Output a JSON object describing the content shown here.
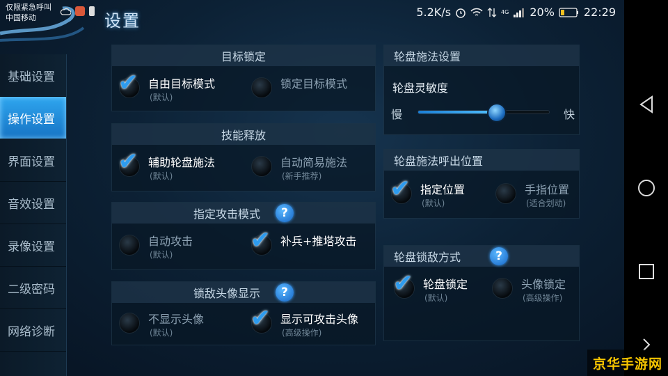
{
  "status_bar": {
    "emergency": "仅限紧急呼叫",
    "carrier": "中国移动",
    "speed": "5.2K/s",
    "battery_pct": "20%",
    "time": "22:29",
    "signal": "4G"
  },
  "title": "设置",
  "sidebar": {
    "items": [
      {
        "label": "基础设置",
        "active": false
      },
      {
        "label": "操作设置",
        "active": true
      },
      {
        "label": "界面设置",
        "active": false
      },
      {
        "label": "音效设置",
        "active": false
      },
      {
        "label": "录像设置",
        "active": false
      },
      {
        "label": "二级密码",
        "active": false
      },
      {
        "label": "网络诊断",
        "active": false
      }
    ]
  },
  "target_lock": {
    "header": "目标锁定",
    "options": [
      {
        "label": "自由目标模式",
        "sub": "(默认)",
        "selected": true
      },
      {
        "label": "锁定目标模式",
        "sub": "",
        "selected": false
      }
    ]
  },
  "skill_release": {
    "header": "技能释放",
    "options": [
      {
        "label": "辅助轮盘施法",
        "sub": "(默认)",
        "selected": true
      },
      {
        "label": "自动简易施法",
        "sub": "(新手推荐)",
        "selected": false
      }
    ]
  },
  "attack_mode": {
    "header": "指定攻击模式",
    "help": "?",
    "options": [
      {
        "label": "自动攻击",
        "sub": "(默认)",
        "selected": false
      },
      {
        "label": "补兵+推塔攻击",
        "sub": "",
        "selected": true
      }
    ]
  },
  "enemy_avatar": {
    "header": "锁敌头像显示",
    "help": "?",
    "options": [
      {
        "label": "不显示头像",
        "sub": "(默认)",
        "selected": false
      },
      {
        "label": "显示可攻击头像",
        "sub": "(高级操作)",
        "selected": true
      }
    ]
  },
  "wheel_settings": {
    "header": "轮盘施法设置",
    "sensitivity_label": "轮盘灵敏度",
    "slow": "慢",
    "fast": "快",
    "sensitivity_value": 0.6
  },
  "wheel_position": {
    "header": "轮盘施法呼出位置",
    "options": [
      {
        "label": "指定位置",
        "sub": "(默认)",
        "selected": true
      },
      {
        "label": "手指位置",
        "sub": "(适合划动)",
        "selected": false
      }
    ]
  },
  "wheel_lock": {
    "header": "轮盘锁敌方式",
    "help": "?",
    "options": [
      {
        "label": "轮盘锁定",
        "sub": "(默认)",
        "selected": true
      },
      {
        "label": "头像锁定",
        "sub": "(高级操作)",
        "selected": false
      }
    ]
  },
  "watermark": "京华手游网",
  "colors": {
    "accent": "#2e9cef",
    "active_tab": "#1f8de0",
    "watermark": "#f5c400"
  },
  "icons": {
    "check": "checkmark-icon",
    "help": "question-icon"
  }
}
